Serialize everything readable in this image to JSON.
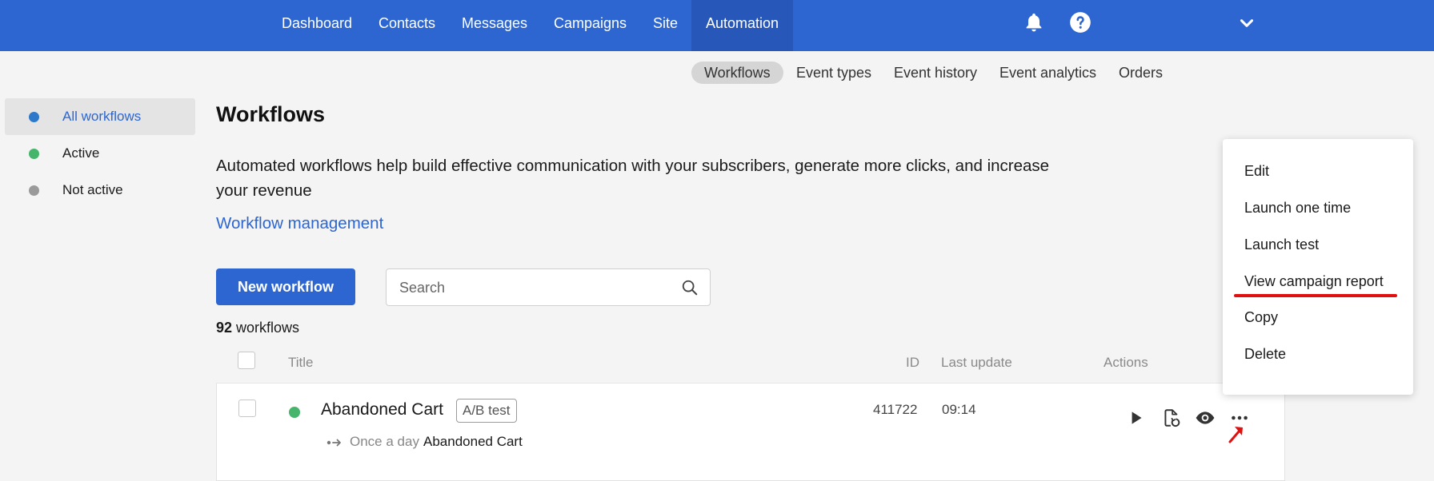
{
  "topnav": {
    "items": [
      "Dashboard",
      "Contacts",
      "Messages",
      "Campaigns",
      "Site",
      "Automation"
    ],
    "active": "Automation",
    "icons": [
      "bell-icon",
      "help-icon",
      "chevron-down-icon"
    ]
  },
  "subnav": {
    "items": [
      "Workflows",
      "Event types",
      "Event history",
      "Event analytics",
      "Orders"
    ],
    "active": "Workflows"
  },
  "sidebar": {
    "items": [
      {
        "label": "All workflows",
        "color": "#2d78c8"
      },
      {
        "label": "Active",
        "color": "#44b56a"
      },
      {
        "label": "Not active",
        "color": "#9a9a9a"
      }
    ]
  },
  "main": {
    "title": "Workflows",
    "intro": "Automated workflows help build effective communication with your subscribers, generate more clicks, and increase your revenue",
    "link": "Workflow management",
    "new_button": "New workflow",
    "search_placeholder": "Search",
    "count": "92",
    "count_suffix": "workflows"
  },
  "table": {
    "headers": {
      "title": "Title",
      "id": "ID",
      "last_update": "Last update",
      "actions": "Actions"
    },
    "rows": [
      {
        "title": "Abandoned Cart",
        "badge": "A/B test",
        "status_color": "#44b56a",
        "frequency": "Once a day",
        "trigger": "Abandoned Cart",
        "id": "411722",
        "last_update": "09:14",
        "actions": [
          "play-icon",
          "restart-icon",
          "eye-icon",
          "more-icon"
        ]
      }
    ]
  },
  "menu": {
    "items": [
      "Edit",
      "Launch one time",
      "Launch test",
      "View campaign report",
      "Copy",
      "Delete"
    ],
    "highlighted": "View campaign report",
    "highlight_color": "#e01010"
  },
  "colors": {
    "brand": "#2d66d1",
    "active_nav": "#2758b9"
  }
}
